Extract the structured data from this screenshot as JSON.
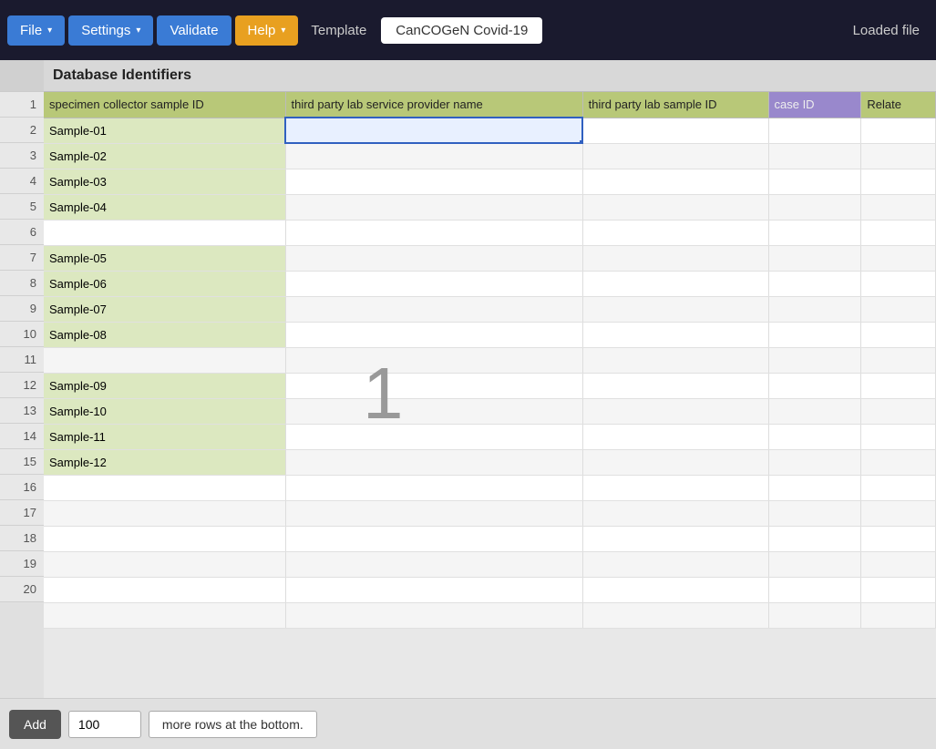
{
  "toolbar": {
    "file_label": "File",
    "settings_label": "Settings",
    "validate_label": "Validate",
    "help_label": "Help",
    "template_label": "Template",
    "template_value": "CanCOGeN Covid-19",
    "loaded_file_label": "Loaded file"
  },
  "section": {
    "title": "Database Identifiers"
  },
  "columns": [
    {
      "id": "specimen",
      "label": "specimen collector sample ID",
      "class": "col-specimen"
    },
    {
      "id": "third_party_lab",
      "label": "third party lab service provider name",
      "class": "col-third-party-lab"
    },
    {
      "id": "third_party_sample",
      "label": "third party lab sample ID",
      "class": "col-third-party-sample"
    },
    {
      "id": "case_id",
      "label": "case ID",
      "class": "col-case-id"
    },
    {
      "id": "relate",
      "label": "Relate",
      "class": "col-relate"
    }
  ],
  "rows": [
    {
      "num": 1,
      "specimen": "Sample-01",
      "active_col": 1
    },
    {
      "num": 2,
      "specimen": "Sample-02"
    },
    {
      "num": 3,
      "specimen": "Sample-03"
    },
    {
      "num": 4,
      "specimen": "Sample-04"
    },
    {
      "num": 5,
      "specimen": ""
    },
    {
      "num": 6,
      "specimen": "Sample-05"
    },
    {
      "num": 7,
      "specimen": "Sample-06"
    },
    {
      "num": 8,
      "specimen": "Sample-07"
    },
    {
      "num": 9,
      "specimen": "Sample-08"
    },
    {
      "num": 10,
      "specimen": ""
    },
    {
      "num": 11,
      "specimen": "Sample-09"
    },
    {
      "num": 12,
      "specimen": "Sample-10"
    },
    {
      "num": 13,
      "specimen": "Sample-11"
    },
    {
      "num": 14,
      "specimen": "Sample-12"
    },
    {
      "num": 15,
      "specimen": ""
    },
    {
      "num": 16,
      "specimen": ""
    },
    {
      "num": 17,
      "specimen": ""
    },
    {
      "num": 18,
      "specimen": ""
    },
    {
      "num": 19,
      "specimen": ""
    },
    {
      "num": 20,
      "specimen": ""
    }
  ],
  "center_indicator": "1",
  "bottom": {
    "add_label": "Add",
    "rows_value": "100",
    "more_rows_label": "more rows at the bottom."
  }
}
